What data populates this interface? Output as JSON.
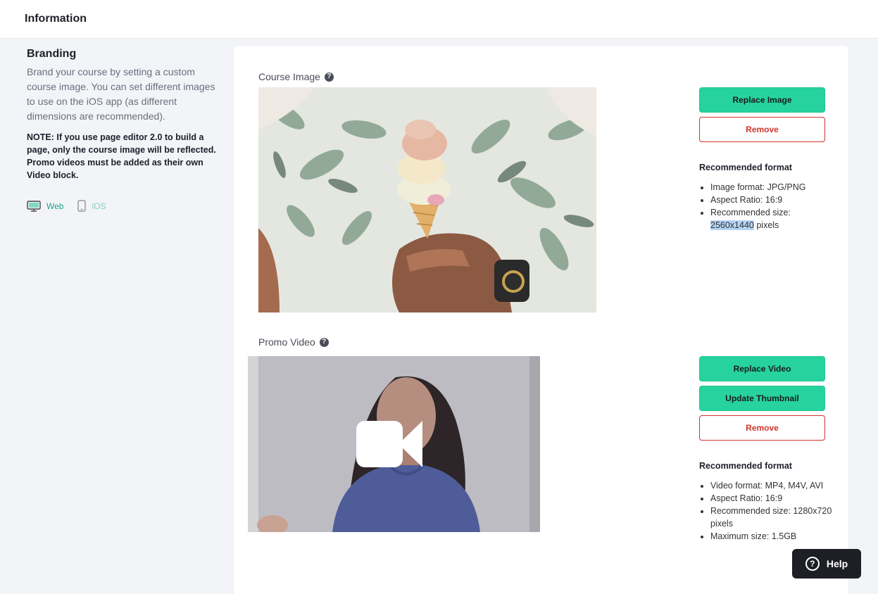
{
  "header": {
    "title": "Information"
  },
  "branding": {
    "title": "Branding",
    "description": "Brand your course by setting a custom course image. You can set different images to use on the iOS app (as different dimensions are recommended).",
    "note": "NOTE: If you use page editor 2.0 to build a page, only the course image will be reflected. Promo videos must be added as their own Video block.",
    "platforms": [
      {
        "label": "Web",
        "icon": "monitor-icon",
        "active": true
      },
      {
        "label": "iOS",
        "icon": "phone-icon",
        "active": false
      }
    ]
  },
  "course_image": {
    "label": "Course Image",
    "buttons": {
      "replace": "Replace Image",
      "remove": "Remove"
    },
    "format": {
      "title": "Recommended format",
      "items": [
        "Image format: JPG/PNG",
        "Aspect Ratio: 16:9",
        "Recommended size:"
      ],
      "size_highlight": "2560x1440",
      "size_suffix": " pixels"
    }
  },
  "promo_video": {
    "label": "Promo Video",
    "buttons": {
      "replace": "Replace Video",
      "thumbnail": "Update Thumbnail",
      "remove": "Remove"
    },
    "format": {
      "title": "Recommended format",
      "items": [
        "Video format: MP4, M4V, AVI",
        "Aspect Ratio: 16:9",
        "Recommended size: 1280x720 pixels",
        "Maximum size: 1.5GB"
      ]
    }
  },
  "help": {
    "label": "Help"
  },
  "colors": {
    "accent": "#26d39e",
    "danger": "#d0342c",
    "link": "#17a58a"
  }
}
